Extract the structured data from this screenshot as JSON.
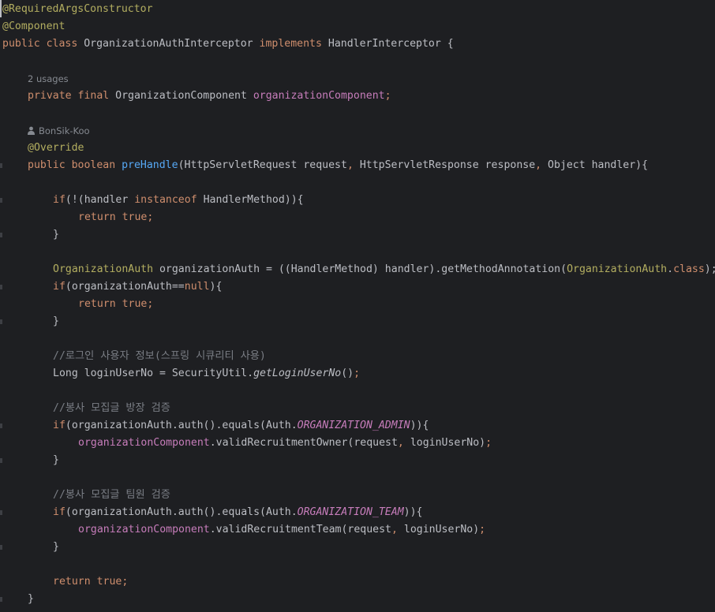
{
  "code": {
    "l1": "@RequiredArgsConstructor",
    "l2": "@Component",
    "l3_kw": "public class",
    "l3_name": " OrganizationAuthInterceptor ",
    "l3_impl": "implements",
    "l3_rest": " HandlerInterceptor {",
    "usages_hint": "2 usages",
    "l5_kw": "private final",
    "l5_type": " OrganizationComponent ",
    "l5_field": "organizationComponent",
    "l5_semi": ";",
    "author_hint": "BonSik-Koo",
    "l7": "@Override",
    "l8_kw": "public boolean ",
    "l8_fn": "preHandle",
    "l8_p1": "(HttpServletRequest request",
    "l8_c1": ",",
    "l8_p2": " HttpServletResponse response",
    "l8_c2": ",",
    "l8_p3": " Object handler){",
    "l10_kw": "if",
    "l10_a": "(!(handler ",
    "l10_inst": "instanceof",
    "l10_b": " HandlerMethod)){",
    "l11_kw": "return true",
    "l11_semi": ";",
    "brace": "}",
    "l14_type": "OrganizationAuth",
    "l14_a": " organizationAuth = ((HandlerMethod) handler).getMethodAnnotation(",
    "l14_ann": "OrganizationAuth",
    "l14_dot": ".",
    "l14_cls": "class",
    "l14_end": ");",
    "l15_kw": "if",
    "l15_a": "(organizationAuth==",
    "l15_null": "null",
    "l15_b": "){",
    "l16_kw": "return true",
    "l16_semi": ";",
    "l19_comment": "//로그인 사용자 정보(스프링 시큐리티 사용)",
    "l20_a": "Long loginUserNo = SecurityUtil.",
    "l20_m": "getLoginUserNo",
    "l20_b": "()",
    "l20_semi": ";",
    "l22_comment": "//봉사 모집글 방장 검증",
    "l23_kw": "if",
    "l23_a": "(organizationAuth.auth().equals(Auth.",
    "l23_const": "ORGANIZATION_ADMIN",
    "l23_b": ")){",
    "l24_field": "organizationComponent",
    "l24_a": ".validRecruitmentOwner(request",
    "l24_c": ",",
    "l24_b": " loginUserNo)",
    "l24_semi": ";",
    "l27_comment": "//봉사 모집글 팀원 검증",
    "l28_kw": "if",
    "l28_a": "(organizationAuth.auth().equals(Auth.",
    "l28_const": "ORGANIZATION_TEAM",
    "l28_b": ")){",
    "l29_field": "organizationComponent",
    "l29_a": ".validRecruitmentTeam(request",
    "l29_c": ",",
    "l29_b": " loginUserNo)",
    "l29_semi": ";",
    "l32_kw": "return true",
    "l32_semi": ";"
  },
  "colors": {
    "background": "#1e1f22",
    "text": "#bcbec4",
    "keyword": "#cf8e6d",
    "annotation": "#b3ae60",
    "field": "#c77dbb",
    "function": "#56a8f5",
    "comment": "#7a7e85"
  },
  "icons": {
    "author": "person-icon"
  }
}
